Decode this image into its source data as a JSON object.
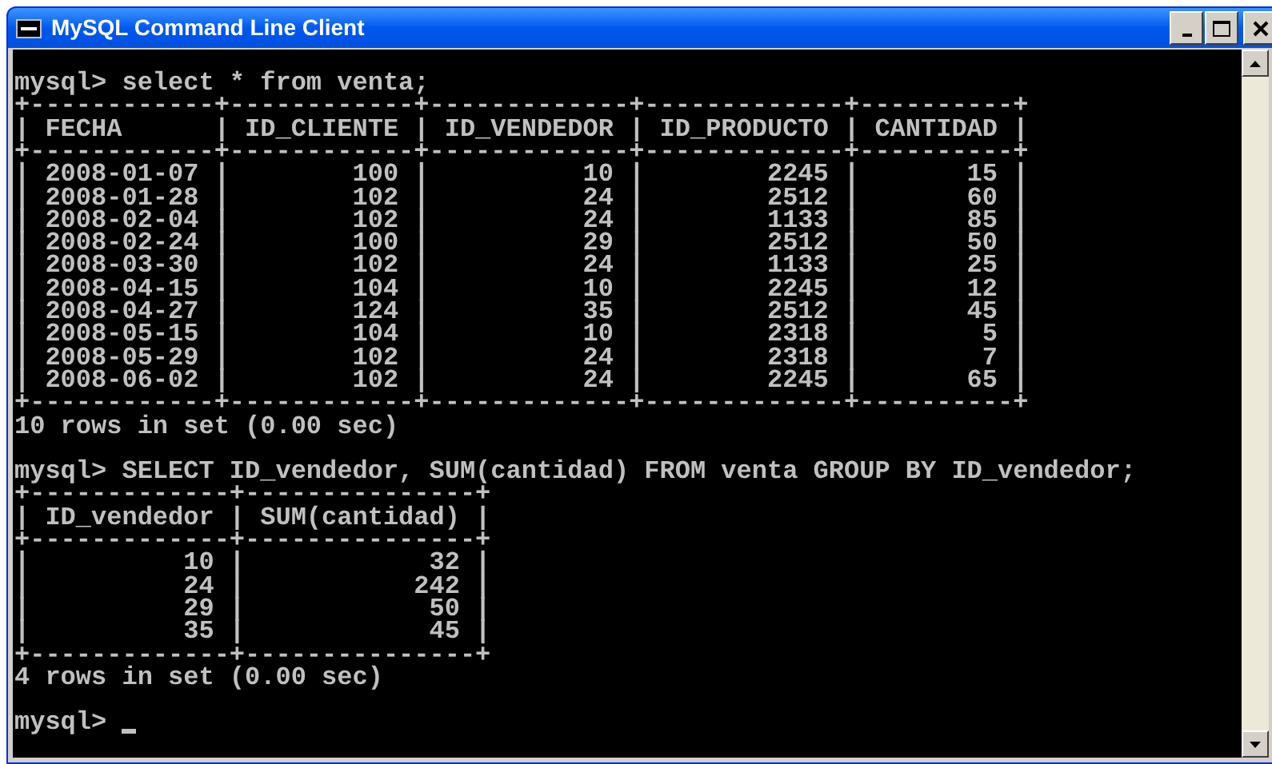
{
  "window": {
    "title": "MySQL Command Line Client"
  },
  "console": {
    "blocks": [
      {
        "lines": [
          "mysql> select * from venta;",
          "+------------+------------+-------------+-------------+----------+",
          "| FECHA      | ID_CLIENTE | ID_VENDEDOR | ID_PRODUCTO | CANTIDAD |",
          "+------------+------------+-------------+-------------+----------+",
          "| 2008-01-07 |        100 |          10 |        2245 |       15 |",
          "| 2008-01-28 |        102 |          24 |        2512 |       60 |",
          "| 2008-02-04 |        102 |          24 |        1133 |       85 |",
          "| 2008-02-24 |        100 |          29 |        2512 |       50 |",
          "| 2008-03-30 |        102 |          24 |        1133 |       25 |",
          "| 2008-04-15 |        104 |          10 |        2245 |       12 |",
          "| 2008-04-27 |        124 |          35 |        2512 |       45 |",
          "| 2008-05-15 |        104 |          10 |        2318 |        5 |",
          "| 2008-05-29 |        102 |          24 |        2318 |        7 |",
          "| 2008-06-02 |        102 |          24 |        2245 |       65 |",
          "+------------+------------+-------------+-------------+----------+",
          "10 rows in set (0.00 sec)"
        ]
      },
      {
        "lines": [
          "mysql> SELECT ID_vendedor, SUM(cantidad) FROM venta GROUP BY ID_vendedor;",
          "+-------------+---------------+",
          "| ID_vendedor | SUM(cantidad) |",
          "+-------------+---------------+",
          "|          10 |            32 |",
          "|          24 |           242 |",
          "|          29 |            50 |",
          "|          35 |            45 |",
          "+-------------+---------------+",
          "4 rows in set (0.00 sec)"
        ]
      },
      {
        "lines": [
          "mysql> "
        ]
      }
    ]
  }
}
